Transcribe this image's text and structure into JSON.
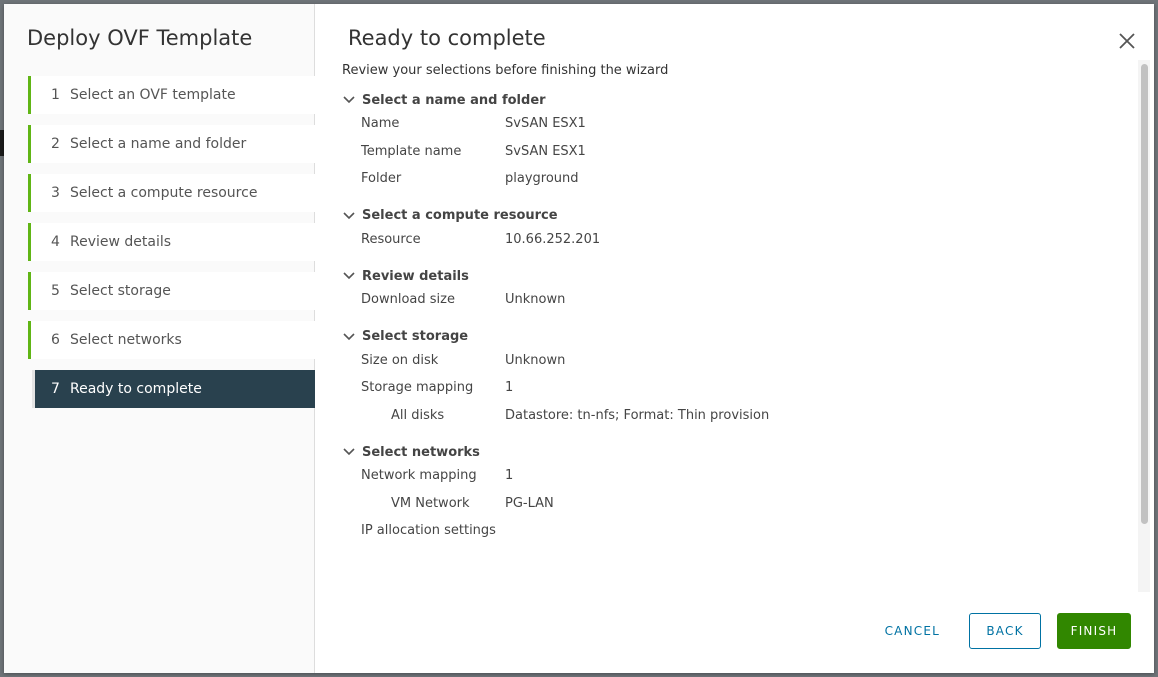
{
  "wizard": {
    "title": "Deploy OVF Template",
    "steps": [
      {
        "num": "1",
        "label": "Select an OVF template"
      },
      {
        "num": "2",
        "label": "Select a name and folder"
      },
      {
        "num": "3",
        "label": "Select a compute resource"
      },
      {
        "num": "4",
        "label": "Review details"
      },
      {
        "num": "5",
        "label": "Select storage"
      },
      {
        "num": "6",
        "label": "Select networks"
      },
      {
        "num": "7",
        "label": "Ready to complete"
      }
    ],
    "active_step": 7,
    "completed_color": "#60b515",
    "active_bg": "#29414e"
  },
  "page": {
    "title": "Ready to complete",
    "subtitle": "Review your selections before finishing the wizard",
    "close_icon": "close-icon",
    "sections": [
      {
        "heading": "Select a name and folder",
        "rows": [
          {
            "key": "Name",
            "value": "SvSAN ESX1"
          },
          {
            "key": "Template name",
            "value": "SvSAN ESX1"
          },
          {
            "key": "Folder",
            "value": "playground"
          }
        ]
      },
      {
        "heading": "Select a compute resource",
        "rows": [
          {
            "key": "Resource",
            "value": "10.66.252.201"
          }
        ]
      },
      {
        "heading": "Review details",
        "rows": [
          {
            "key": "Download size",
            "value": "Unknown"
          }
        ]
      },
      {
        "heading": "Select storage",
        "rows": [
          {
            "key": "Size on disk",
            "value": "Unknown"
          },
          {
            "key": "Storage mapping",
            "value": "1"
          },
          {
            "key": "All disks",
            "value": "Datastore: tn-nfs; Format: Thin provision"
          }
        ]
      },
      {
        "heading": "Select networks",
        "rows": [
          {
            "key": "Network mapping",
            "value": "1"
          },
          {
            "key": "VM Network",
            "value": "PG-LAN"
          },
          {
            "key": "IP allocation settings",
            "value": ""
          }
        ]
      }
    ]
  },
  "footer": {
    "cancel_label": "CANCEL",
    "back_label": "BACK",
    "finish_label": "FINISH",
    "primary_color": "#318700",
    "link_color": "#0072a3"
  }
}
